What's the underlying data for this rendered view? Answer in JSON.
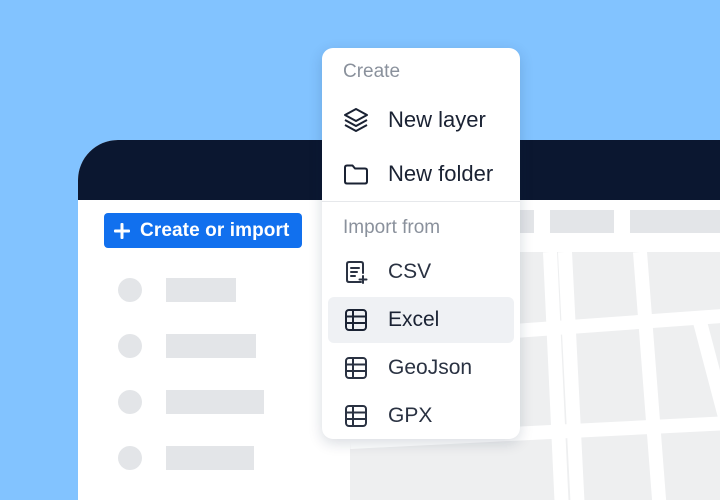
{
  "app": {
    "create_button_label": "Create or import"
  },
  "menu": {
    "create_section_label": "Create",
    "create_items": [
      {
        "label": "New layer",
        "icon": "layers-icon"
      },
      {
        "label": "New folder",
        "icon": "folder-icon"
      }
    ],
    "import_section_label": "Import from",
    "import_items": [
      {
        "label": "CSV",
        "icon": "csv-file-icon"
      },
      {
        "label": "Excel",
        "icon": "table-icon",
        "highlighted": true
      },
      {
        "label": "GeoJson",
        "icon": "table-icon"
      },
      {
        "label": "GPX",
        "icon": "table-icon"
      }
    ]
  },
  "colors": {
    "background": "#82C3FF",
    "titlebar": "#0B1730",
    "accent": "#1170EE",
    "menu_text": "#1A2233",
    "muted_text": "#8A919C"
  }
}
